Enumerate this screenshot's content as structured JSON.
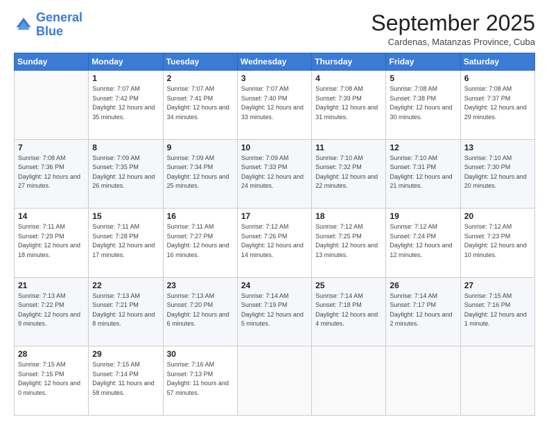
{
  "logo": {
    "line1": "General",
    "line2": "Blue"
  },
  "header": {
    "title": "September 2025",
    "location": "Cardenas, Matanzas Province, Cuba"
  },
  "weekdays": [
    "Sunday",
    "Monday",
    "Tuesday",
    "Wednesday",
    "Thursday",
    "Friday",
    "Saturday"
  ],
  "weeks": [
    [
      {
        "day": "",
        "sunrise": "",
        "sunset": "",
        "daylight": ""
      },
      {
        "day": "1",
        "sunrise": "Sunrise: 7:07 AM",
        "sunset": "Sunset: 7:42 PM",
        "daylight": "Daylight: 12 hours and 35 minutes."
      },
      {
        "day": "2",
        "sunrise": "Sunrise: 7:07 AM",
        "sunset": "Sunset: 7:41 PM",
        "daylight": "Daylight: 12 hours and 34 minutes."
      },
      {
        "day": "3",
        "sunrise": "Sunrise: 7:07 AM",
        "sunset": "Sunset: 7:40 PM",
        "daylight": "Daylight: 12 hours and 33 minutes."
      },
      {
        "day": "4",
        "sunrise": "Sunrise: 7:08 AM",
        "sunset": "Sunset: 7:39 PM",
        "daylight": "Daylight: 12 hours and 31 minutes."
      },
      {
        "day": "5",
        "sunrise": "Sunrise: 7:08 AM",
        "sunset": "Sunset: 7:38 PM",
        "daylight": "Daylight: 12 hours and 30 minutes."
      },
      {
        "day": "6",
        "sunrise": "Sunrise: 7:08 AM",
        "sunset": "Sunset: 7:37 PM",
        "daylight": "Daylight: 12 hours and 29 minutes."
      }
    ],
    [
      {
        "day": "7",
        "sunrise": "Sunrise: 7:08 AM",
        "sunset": "Sunset: 7:36 PM",
        "daylight": "Daylight: 12 hours and 27 minutes."
      },
      {
        "day": "8",
        "sunrise": "Sunrise: 7:09 AM",
        "sunset": "Sunset: 7:35 PM",
        "daylight": "Daylight: 12 hours and 26 minutes."
      },
      {
        "day": "9",
        "sunrise": "Sunrise: 7:09 AM",
        "sunset": "Sunset: 7:34 PM",
        "daylight": "Daylight: 12 hours and 25 minutes."
      },
      {
        "day": "10",
        "sunrise": "Sunrise: 7:09 AM",
        "sunset": "Sunset: 7:33 PM",
        "daylight": "Daylight: 12 hours and 24 minutes."
      },
      {
        "day": "11",
        "sunrise": "Sunrise: 7:10 AM",
        "sunset": "Sunset: 7:32 PM",
        "daylight": "Daylight: 12 hours and 22 minutes."
      },
      {
        "day": "12",
        "sunrise": "Sunrise: 7:10 AM",
        "sunset": "Sunset: 7:31 PM",
        "daylight": "Daylight: 12 hours and 21 minutes."
      },
      {
        "day": "13",
        "sunrise": "Sunrise: 7:10 AM",
        "sunset": "Sunset: 7:30 PM",
        "daylight": "Daylight: 12 hours and 20 minutes."
      }
    ],
    [
      {
        "day": "14",
        "sunrise": "Sunrise: 7:11 AM",
        "sunset": "Sunset: 7:29 PM",
        "daylight": "Daylight: 12 hours and 18 minutes."
      },
      {
        "day": "15",
        "sunrise": "Sunrise: 7:11 AM",
        "sunset": "Sunset: 7:28 PM",
        "daylight": "Daylight: 12 hours and 17 minutes."
      },
      {
        "day": "16",
        "sunrise": "Sunrise: 7:11 AM",
        "sunset": "Sunset: 7:27 PM",
        "daylight": "Daylight: 12 hours and 16 minutes."
      },
      {
        "day": "17",
        "sunrise": "Sunrise: 7:12 AM",
        "sunset": "Sunset: 7:26 PM",
        "daylight": "Daylight: 12 hours and 14 minutes."
      },
      {
        "day": "18",
        "sunrise": "Sunrise: 7:12 AM",
        "sunset": "Sunset: 7:25 PM",
        "daylight": "Daylight: 12 hours and 13 minutes."
      },
      {
        "day": "19",
        "sunrise": "Sunrise: 7:12 AM",
        "sunset": "Sunset: 7:24 PM",
        "daylight": "Daylight: 12 hours and 12 minutes."
      },
      {
        "day": "20",
        "sunrise": "Sunrise: 7:12 AM",
        "sunset": "Sunset: 7:23 PM",
        "daylight": "Daylight: 12 hours and 10 minutes."
      }
    ],
    [
      {
        "day": "21",
        "sunrise": "Sunrise: 7:13 AM",
        "sunset": "Sunset: 7:22 PM",
        "daylight": "Daylight: 12 hours and 9 minutes."
      },
      {
        "day": "22",
        "sunrise": "Sunrise: 7:13 AM",
        "sunset": "Sunset: 7:21 PM",
        "daylight": "Daylight: 12 hours and 8 minutes."
      },
      {
        "day": "23",
        "sunrise": "Sunrise: 7:13 AM",
        "sunset": "Sunset: 7:20 PM",
        "daylight": "Daylight: 12 hours and 6 minutes."
      },
      {
        "day": "24",
        "sunrise": "Sunrise: 7:14 AM",
        "sunset": "Sunset: 7:19 PM",
        "daylight": "Daylight: 12 hours and 5 minutes."
      },
      {
        "day": "25",
        "sunrise": "Sunrise: 7:14 AM",
        "sunset": "Sunset: 7:18 PM",
        "daylight": "Daylight: 12 hours and 4 minutes."
      },
      {
        "day": "26",
        "sunrise": "Sunrise: 7:14 AM",
        "sunset": "Sunset: 7:17 PM",
        "daylight": "Daylight: 12 hours and 2 minutes."
      },
      {
        "day": "27",
        "sunrise": "Sunrise: 7:15 AM",
        "sunset": "Sunset: 7:16 PM",
        "daylight": "Daylight: 12 hours and 1 minute."
      }
    ],
    [
      {
        "day": "28",
        "sunrise": "Sunrise: 7:15 AM",
        "sunset": "Sunset: 7:15 PM",
        "daylight": "Daylight: 12 hours and 0 minutes."
      },
      {
        "day": "29",
        "sunrise": "Sunrise: 7:15 AM",
        "sunset": "Sunset: 7:14 PM",
        "daylight": "Daylight: 11 hours and 58 minutes."
      },
      {
        "day": "30",
        "sunrise": "Sunrise: 7:16 AM",
        "sunset": "Sunset: 7:13 PM",
        "daylight": "Daylight: 11 hours and 57 minutes."
      },
      {
        "day": "",
        "sunrise": "",
        "sunset": "",
        "daylight": ""
      },
      {
        "day": "",
        "sunrise": "",
        "sunset": "",
        "daylight": ""
      },
      {
        "day": "",
        "sunrise": "",
        "sunset": "",
        "daylight": ""
      },
      {
        "day": "",
        "sunrise": "",
        "sunset": "",
        "daylight": ""
      }
    ]
  ]
}
